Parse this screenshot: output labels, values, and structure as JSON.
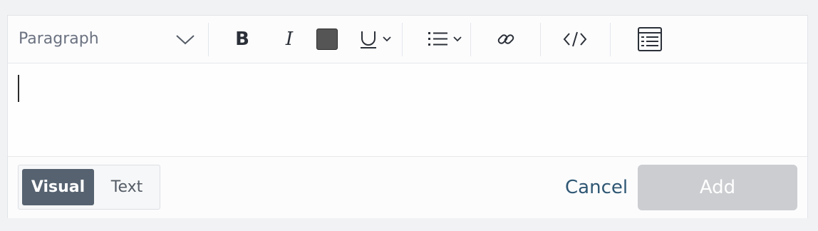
{
  "toolbar": {
    "block_format": "Paragraph",
    "bold": "B",
    "italic": "I",
    "text_color": "#555555"
  },
  "footer": {
    "visual_label": "Visual",
    "text_label": "Text",
    "cancel_label": "Cancel",
    "add_label": "Add"
  },
  "colors": {
    "active_mode": "#566270",
    "cancel_link": "#2f5773",
    "add_disabled": "#cbcdd0"
  }
}
